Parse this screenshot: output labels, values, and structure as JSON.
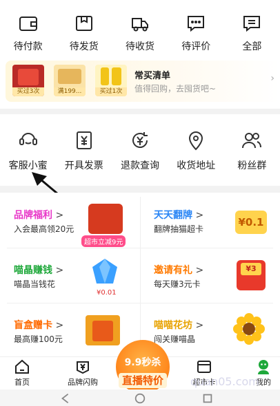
{
  "orders": [
    {
      "label": "待付款",
      "icon": "wallet-icon"
    },
    {
      "label": "待发货",
      "icon": "package-icon"
    },
    {
      "label": "待收货",
      "icon": "truck-icon"
    },
    {
      "label": "待评价",
      "icon": "comment-icon"
    },
    {
      "label": "全部",
      "icon": "list-icon"
    }
  ],
  "recent": {
    "title": "常买清单",
    "subtitle": "值得回购，去囤货吧~",
    "badges": [
      "买过3次",
      "满199...",
      "买过1次"
    ]
  },
  "services": [
    {
      "label": "客服小蜜",
      "icon": "customer-service-icon"
    },
    {
      "label": "开具发票",
      "icon": "invoice-icon"
    },
    {
      "label": "退款查询",
      "icon": "refund-icon"
    },
    {
      "label": "收货地址",
      "icon": "location-icon"
    },
    {
      "label": "粉丝群",
      "icon": "fans-group-icon"
    }
  ],
  "promos": [
    {
      "title": "品牌福利",
      "subtitle": "入会最高领20元",
      "color": "#e838c8",
      "tag": "超市立减9元"
    },
    {
      "title": "天天翻牌",
      "subtitle": "翻牌抽猫超卡",
      "color": "#2b86f5",
      "tag": "¥0.1"
    },
    {
      "title": "喵晶赚钱",
      "subtitle": "喵晶当钱花",
      "color": "#1ea83a",
      "tag": "¥0.01"
    },
    {
      "title": "邀请有礼",
      "subtitle": "每天赚3元卡",
      "color": "#ff7a00",
      "tag": "¥3"
    },
    {
      "title": "盲盒赠卡",
      "subtitle": "最高赚100元",
      "color": "#ff6a00",
      "tag": ""
    },
    {
      "title": "喵喵花坊",
      "subtitle": "闯关赚喵晶",
      "color": "#e8a200",
      "tag": ""
    }
  ],
  "tabbar": {
    "home": "首页",
    "brand": "品牌闪购",
    "live_top": "9.9秒杀",
    "live_bottom": "直播特价",
    "card": "超市卡",
    "mine": "我的"
  },
  "watermark": "quan05.com",
  "colors": {
    "accent": "#ff7a00",
    "gold": "#ffd34d",
    "green": "#1ea83a"
  }
}
